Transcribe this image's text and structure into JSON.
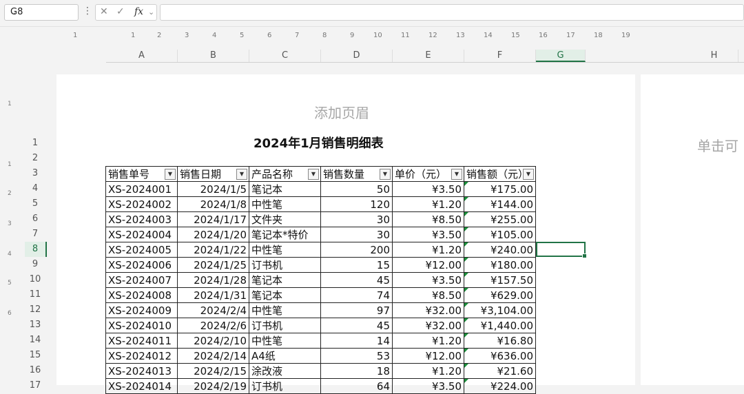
{
  "formula_bar": {
    "cell_ref": "G8",
    "cancel_icon": "✕",
    "enter_icon": "✓",
    "fx_label": "fx",
    "formula_value": ""
  },
  "ruler_h": [
    "1",
    "1",
    "2",
    "3",
    "4",
    "5",
    "6",
    "7",
    "8",
    "9",
    "10",
    "11",
    "12",
    "13",
    "14",
    "15",
    "16",
    "17",
    "18",
    "19"
  ],
  "columns": [
    "A",
    "B",
    "C",
    "D",
    "E",
    "F",
    "G",
    "H"
  ],
  "selected_column": "G",
  "rows": [
    "1",
    "2",
    "3",
    "4",
    "5",
    "6",
    "7",
    "8",
    "9",
    "10",
    "11",
    "12",
    "13",
    "14",
    "15",
    "16",
    "17"
  ],
  "selected_row": "8",
  "ruler_v": [
    "1",
    "1",
    "2",
    "3",
    "4",
    "5",
    "6"
  ],
  "page": {
    "header_placeholder": "添加页眉",
    "next_page_placeholder": "单击可"
  },
  "sheet_title": "2024年1月销售明细表",
  "table": {
    "headers": [
      "销售单号",
      "销售日期",
      "产品名称",
      "销售数量",
      "单价（元）",
      "销售额（元）"
    ],
    "rows": [
      [
        "XS-2024001",
        "2024/1/5",
        "笔记本",
        "50",
        "¥3.50",
        "¥175.00"
      ],
      [
        "XS-2024002",
        "2024/1/8",
        "中性笔",
        "120",
        "¥1.20",
        "¥144.00"
      ],
      [
        "XS-2024003",
        "2024/1/17",
        "文件夹",
        "30",
        "¥8.50",
        "¥255.00"
      ],
      [
        "XS-2024004",
        "2024/1/20",
        "笔记本*特价",
        "30",
        "¥3.50",
        "¥105.00"
      ],
      [
        "XS-2024005",
        "2024/1/22",
        "中性笔",
        "200",
        "¥1.20",
        "¥240.00"
      ],
      [
        "XS-2024006",
        "2024/1/25",
        "订书机",
        "15",
        "¥12.00",
        "¥180.00"
      ],
      [
        "XS-2024007",
        "2024/1/28",
        "笔记本",
        "45",
        "¥3.50",
        "¥157.50"
      ],
      [
        "XS-2024008",
        "2024/1/31",
        "笔记本",
        "74",
        "¥8.50",
        "¥629.00"
      ],
      [
        "XS-2024009",
        "2024/2/4",
        "中性笔",
        "97",
        "¥32.00",
        "¥3,104.00"
      ],
      [
        "XS-2024010",
        "2024/2/6",
        "订书机",
        "45",
        "¥32.00",
        "¥1,440.00"
      ],
      [
        "XS-2024011",
        "2024/2/10",
        "中性笔",
        "14",
        "¥1.20",
        "¥16.80"
      ],
      [
        "XS-2024012",
        "2024/2/14",
        "A4纸",
        "53",
        "¥12.00",
        "¥636.00"
      ],
      [
        "XS-2024013",
        "2024/2/15",
        "涂改液",
        "18",
        "¥1.20",
        "¥21.60"
      ],
      [
        "XS-2024014",
        "2024/2/19",
        "订书机",
        "64",
        "¥3.50",
        "¥224.00"
      ]
    ]
  }
}
